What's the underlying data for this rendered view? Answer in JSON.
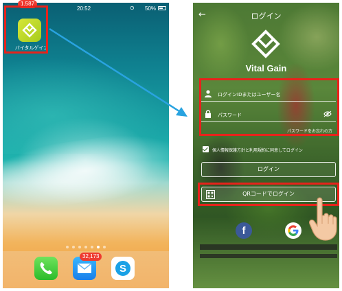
{
  "home_screen": {
    "status_bar": {
      "time": "20:52",
      "battery": "50%"
    },
    "app": {
      "name": "バイタルゲイン",
      "badge": "1,587"
    },
    "dock": {
      "mail_badge": "32,173",
      "apps": [
        "phone-icon",
        "mail-icon",
        "skype-icon"
      ]
    },
    "page_dots": 7,
    "active_dot": 6
  },
  "login_screen": {
    "title": "ログイン",
    "brand": "Vital Gain",
    "username_placeholder": "ログインIDまたはユーザー名",
    "password_placeholder": "パスワード",
    "forgot_password": "パスワードをお忘れの方",
    "consent_text": "個人情報保護方針と利用規約に同意してログイン",
    "login_button": "ログイン",
    "qr_login_button": "QRコードでログイン",
    "social": [
      "facebook-icon",
      "google-icon"
    ]
  },
  "colors": {
    "highlight_red": "#e8221b",
    "arrow_blue": "#29a3e0",
    "app_green": "#c5dc2e"
  }
}
